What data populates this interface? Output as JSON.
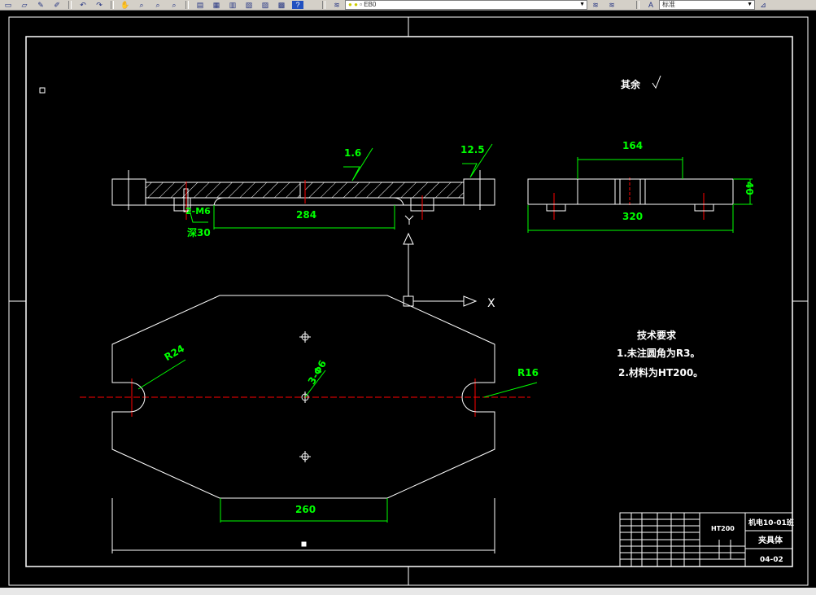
{
  "toolbar": {
    "icons": [
      "new-icon",
      "open-icon",
      "edit-icon",
      "match-prop-icon",
      "undo-icon",
      "redo-icon",
      "pan-icon",
      "zoom-realtime-icon",
      "zoom-window-icon",
      "zoom-previous-icon",
      "properties-icon",
      "design-center-icon",
      "tool-palette-icon",
      "sheetset-icon",
      "markup-icon",
      "calculator-icon",
      "help-icon",
      "layer-manager-icon",
      "layer-state-icon",
      "make-current-icon"
    ],
    "layer_value": "EB0",
    "text_style_value": "标准",
    "help_glyph": "?"
  },
  "drawing": {
    "surface_note": "其余",
    "roughness_top_1": "1.6",
    "roughness_top_2": "12.5",
    "thread_label": "2-M6",
    "depth_label": "深30",
    "dim_284": "284",
    "dim_164": "164",
    "dim_320": "320",
    "dim_40": "40",
    "dim_r24": "R24",
    "dim_r16": "R16",
    "dim_3phi6": "3-Φ6",
    "dim_260": "260",
    "ucs_x": "X",
    "ucs_y": "Y",
    "tech_title": "技术要求",
    "tech_items": [
      "1.未注圆角为R3。",
      "2.材料为HT200。"
    ],
    "title_block": {
      "material": "HT200",
      "class": "机电10-01班",
      "part_name": "夹具体",
      "drawing_no": "04-02"
    }
  },
  "colors": {
    "background": "#000000",
    "lines": "#ffffff",
    "dims": "#00ff00",
    "center": "#ff0000",
    "toolbar": "#d4d0c8"
  }
}
